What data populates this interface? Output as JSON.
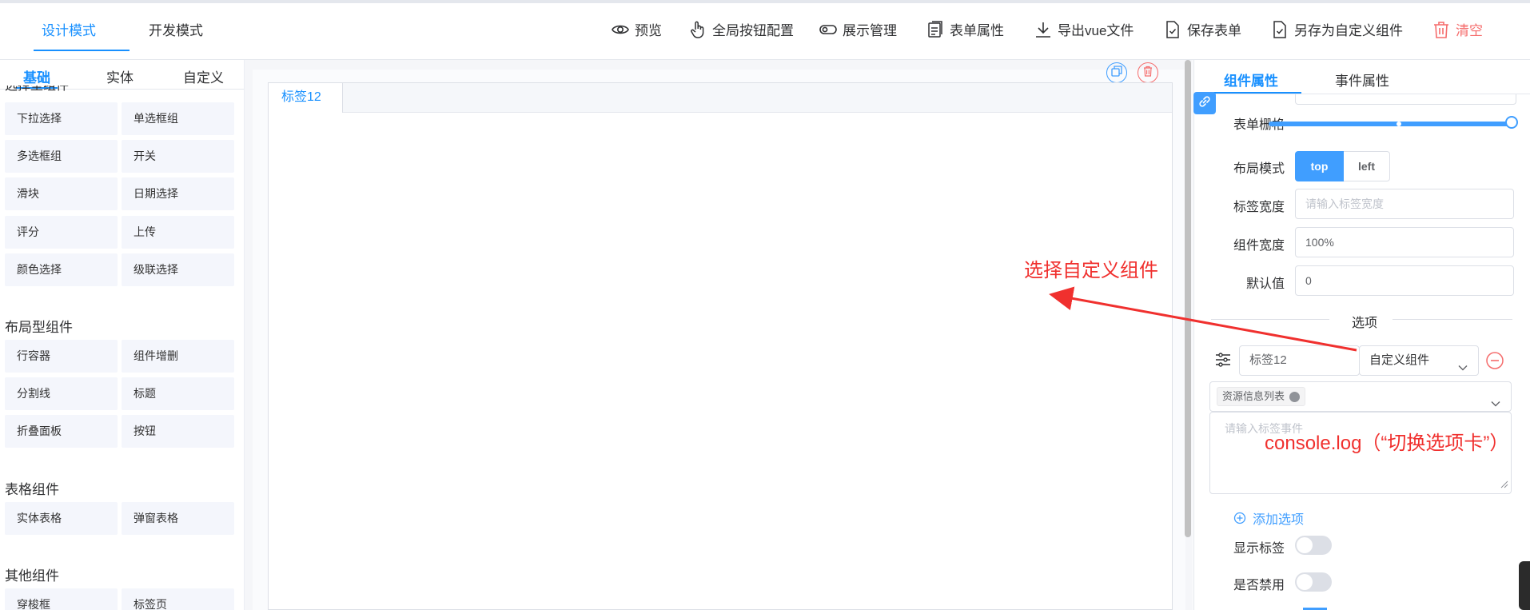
{
  "header": {
    "modes": [
      "设计模式",
      "开发模式"
    ],
    "toolbar": {
      "preview": "预览",
      "global_buttons": "全局按钮配置",
      "display_manage": "展示管理",
      "form_props": "表单属性",
      "export_vue": "导出vue文件",
      "save_form": "保存表单",
      "save_as_custom": "另存为自定义组件",
      "clear": "清空"
    }
  },
  "left_panel": {
    "tabs": [
      "基础",
      "实体",
      "自定义"
    ],
    "partial_title": "选择型组件",
    "groups": [
      {
        "title": "",
        "items": [
          "下拉选择",
          "单选框组",
          "多选框组",
          "开关",
          "滑块",
          "日期选择",
          "评分",
          "上传",
          "颜色选择",
          "级联选择"
        ]
      },
      {
        "title": "布局型组件",
        "items": [
          "行容器",
          "组件增删",
          "分割线",
          "标题",
          "折叠面板",
          "按钮"
        ]
      },
      {
        "title": "表格组件",
        "items": [
          "实体表格",
          "弹窗表格"
        ]
      },
      {
        "title": "其他组件",
        "items": [
          "穿梭框",
          "标签页"
        ]
      }
    ]
  },
  "canvas": {
    "tab_label": "标签12",
    "annotation_label": "选择自定义组件"
  },
  "right_panel": {
    "tabs": [
      "组件属性",
      "事件属性"
    ],
    "form": {
      "grid_label": "表单栅格",
      "grid_value": 1.0,
      "layout_label": "布局模式",
      "layout_options": [
        "top",
        "left"
      ],
      "layout_selected": "top",
      "label_width_label": "标签宽度",
      "label_width_placeholder": "请输入标签宽度",
      "comp_width_label": "组件宽度",
      "comp_width_value": "100%",
      "default_label": "默认值",
      "default_value": "0"
    },
    "options": {
      "divider_text": "选项",
      "tab_name_value": "标签12",
      "tab_type_value": "自定义组件",
      "resource_tag": "资源信息列表",
      "event_placeholder": "请输入标签事件",
      "event_annotation": "console.log（“切换选项卡”）",
      "add_option": "添加选项"
    },
    "show_label": {
      "label": "显示标签",
      "on": false
    },
    "disabled": {
      "label": "是否禁用",
      "on": false
    }
  },
  "colors": {
    "accent": "#1890ff",
    "primary": "#409eff",
    "danger": "#f56c6c",
    "annotation": "#f0302e"
  }
}
